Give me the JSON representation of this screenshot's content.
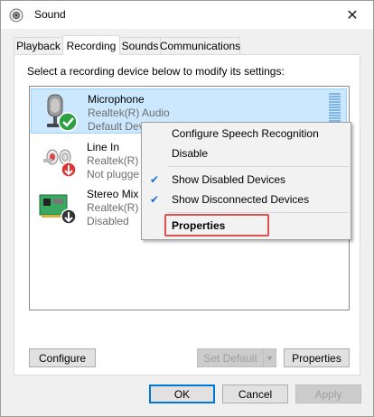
{
  "window": {
    "title": "Sound",
    "close_label": "✕"
  },
  "tabs": [
    {
      "label": "Playback"
    },
    {
      "label": "Recording"
    },
    {
      "label": "Sounds"
    },
    {
      "label": "Communications"
    }
  ],
  "instruction": "Select a recording device below to modify its settings:",
  "devices": [
    {
      "name": "Microphone",
      "line1": "Realtek(R) Audio",
      "line2": "Default Devi",
      "status": "default-check"
    },
    {
      "name": "Line In",
      "line1": "Realtek(R) A",
      "line2": "Not plugge",
      "status": "unplugged"
    },
    {
      "name": "Stereo Mix",
      "line1": "Realtek(R) A",
      "line2": "Disabled",
      "status": "disabled"
    }
  ],
  "context_menu": {
    "items": [
      {
        "label": "Configure Speech Recognition"
      },
      {
        "label": "Disable"
      },
      {
        "label": "Show Disabled Devices",
        "checked": true
      },
      {
        "label": "Show Disconnected Devices",
        "checked": true
      },
      {
        "label": "Properties",
        "bold": true
      }
    ],
    "check_glyph": "✔"
  },
  "buttons": {
    "configure": "Configure",
    "set_default": "Set Default",
    "properties": "Properties",
    "ok": "OK",
    "cancel": "Cancel",
    "apply": "Apply"
  },
  "colors": {
    "selection": "#cce8ff",
    "accent": "#0078d7",
    "highlight_box": "#e05050",
    "check_green": "#2ea043"
  }
}
